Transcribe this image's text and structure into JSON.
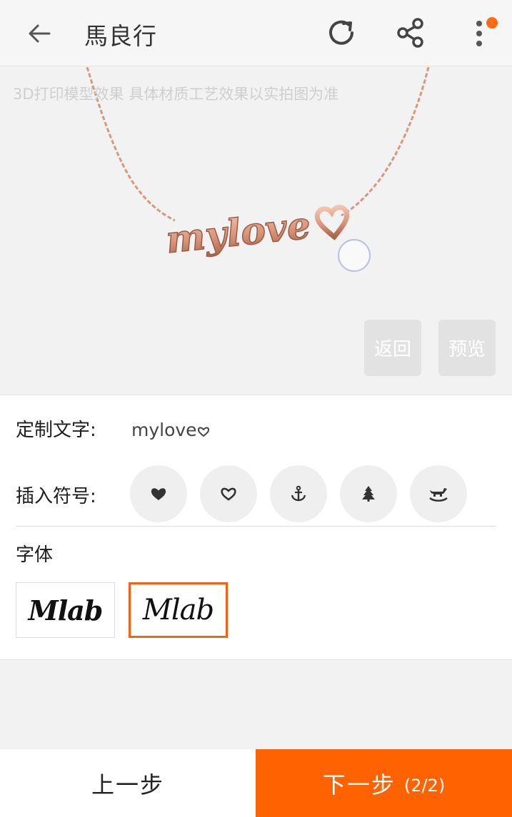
{
  "topbar": {
    "title": "馬良行",
    "icons": [
      "back-arrow-icon",
      "refresh-icon",
      "share-icon",
      "more-vertical-icon"
    ],
    "badge_color": "#ff6a13"
  },
  "preview": {
    "note": "3D打印模型效果 具体材质工艺效果以实拍图为准",
    "model_text": "mylove",
    "back_label": "返回",
    "preview_label": "预览",
    "metal_color": "#d9957a"
  },
  "form": {
    "custom_text_label": "定制文字:",
    "custom_text_value": "mylove",
    "symbol_label": "插入符号:",
    "symbols": [
      "heart-solid-icon",
      "heart-outline-icon",
      "anchor-icon",
      "tree-icon",
      "rocking-horse-icon"
    ],
    "font_label": "字体",
    "fonts": [
      {
        "sample": "Mlab",
        "selected": false
      },
      {
        "sample": "Mlab",
        "selected": true
      }
    ],
    "selected_color": "#ef6418"
  },
  "bottom": {
    "prev_label": "上一步",
    "next_label": "下一步",
    "step_indicator": "(2/2)",
    "accent": "#ff6200"
  }
}
